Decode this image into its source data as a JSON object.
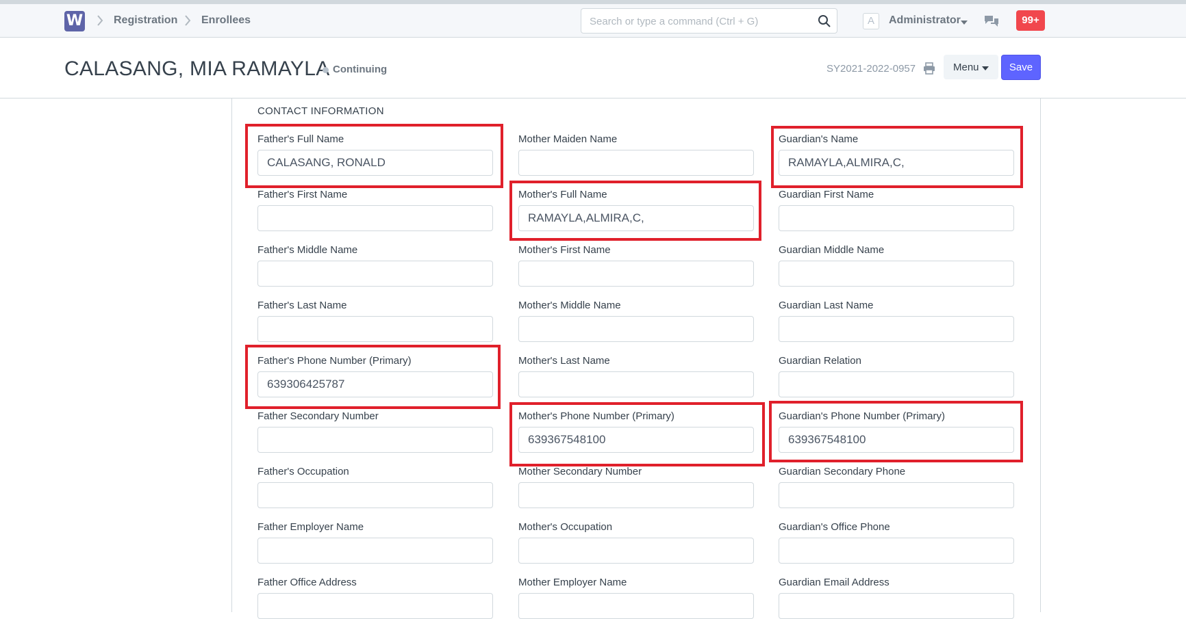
{
  "navbar": {
    "logo_letter": "W",
    "breadcrumbs": [
      "Registration",
      "Enrollees"
    ],
    "search_placeholder": "Search or type a command (Ctrl + G)",
    "avatar_letter": "A",
    "user_name": "Administrator",
    "notification_count": "99+"
  },
  "page": {
    "title": "CALASANG, MIA RAMAYLA",
    "status": "Continuing",
    "doc_id": "SY2021-2022-0957",
    "menu_label": "Menu",
    "save_label": "Save"
  },
  "section": {
    "title": "CONTACT INFORMATION"
  },
  "fields": {
    "col1": [
      {
        "label": "Father's Full Name",
        "value": "CALASANG, RONALD"
      },
      {
        "label": "Father's First Name",
        "value": ""
      },
      {
        "label": "Father's Middle Name",
        "value": ""
      },
      {
        "label": "Father's Last Name",
        "value": ""
      },
      {
        "label": "Father's Phone Number (Primary)",
        "value": "639306425787"
      },
      {
        "label": "Father Secondary Number",
        "value": ""
      },
      {
        "label": "Father's Occupation",
        "value": ""
      },
      {
        "label": "Father Employer Name",
        "value": ""
      },
      {
        "label": "Father Office Address",
        "value": ""
      }
    ],
    "col2": [
      {
        "label": "Mother Maiden Name",
        "value": ""
      },
      {
        "label": "Mother's Full Name",
        "value": "RAMAYLA,ALMIRA,C,"
      },
      {
        "label": "Mother's First Name",
        "value": ""
      },
      {
        "label": "Mother's Middle Name",
        "value": ""
      },
      {
        "label": "Mother's Last Name",
        "value": ""
      },
      {
        "label": "Mother's Phone Number (Primary)",
        "value": "639367548100"
      },
      {
        "label": "Mother Secondary Number",
        "value": ""
      },
      {
        "label": "Mother's Occupation",
        "value": ""
      },
      {
        "label": "Mother Employer Name",
        "value": ""
      }
    ],
    "col3": [
      {
        "label": "Guardian's Name",
        "value": "RAMAYLA,ALMIRA,C,"
      },
      {
        "label": "Guardian First Name",
        "value": ""
      },
      {
        "label": "Guardian Middle Name",
        "value": ""
      },
      {
        "label": "Guardian Last Name",
        "value": ""
      },
      {
        "label": "Guardian Relation",
        "value": ""
      },
      {
        "label": "Guardian's Phone Number (Primary)",
        "value": "639367548100"
      },
      {
        "label": "Guardian Secondary Phone",
        "value": ""
      },
      {
        "label": "Guardian's Office Phone",
        "value": ""
      },
      {
        "label": "Guardian Email Address",
        "value": ""
      }
    ]
  },
  "colors": {
    "highlight": "#e0202b",
    "primary": "#5e64ff",
    "notification": "#f1474d"
  }
}
